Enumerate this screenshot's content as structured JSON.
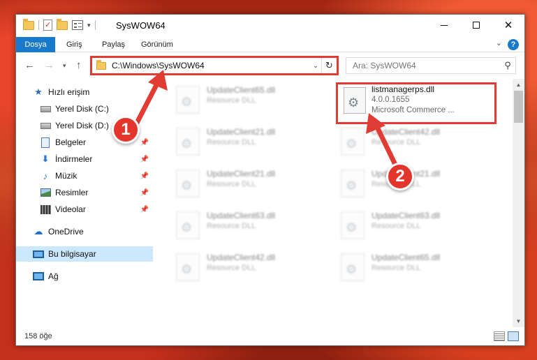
{
  "window": {
    "title": "SysWOW64",
    "minimize_label": "",
    "close_label": "✕"
  },
  "ribbon": {
    "tabs": [
      {
        "label": "Dosya"
      },
      {
        "label": "Giriş"
      },
      {
        "label": "Paylaş"
      },
      {
        "label": "Görünüm"
      }
    ],
    "help": "?"
  },
  "nav": {
    "address": "C:\\Windows\\SysWOW64",
    "search_placeholder": "Ara: SysWOW64"
  },
  "sidebar": {
    "items": [
      {
        "label": "Hızlı erişim"
      },
      {
        "label": "Yerel Disk (C:)"
      },
      {
        "label": "Yerel Disk (D:)"
      },
      {
        "label": "Belgeler"
      },
      {
        "label": "İndirmeler"
      },
      {
        "label": "Müzik"
      },
      {
        "label": "Resimler"
      },
      {
        "label": "Videolar"
      },
      {
        "label": "OneDrive"
      },
      {
        "label": "Bu bilgisayar"
      },
      {
        "label": "Ağ"
      }
    ]
  },
  "files": {
    "left": [
      {
        "name": "UpdateClient65.dll",
        "type": "Resource DLL"
      },
      {
        "name": "UpdateClient21.dll",
        "type": "Resource DLL"
      },
      {
        "name": "UpdateClient21.dll",
        "type": "Resource DLL"
      },
      {
        "name": "UpdateClient63.dll",
        "type": "Resource DLL"
      },
      {
        "name": "UpdateClient42.dll",
        "type": "Resource DLL"
      }
    ],
    "right": [
      {
        "name": "UpdateClient42.dll",
        "type": "Resource DLL"
      },
      {
        "name": "UpdateClient21.dll",
        "type": "Resource DLL"
      },
      {
        "name": "UpdateClient63.dll",
        "type": "Resource DLL"
      },
      {
        "name": "UpdateClient65.dll",
        "type": "Resource DLL"
      }
    ],
    "target": {
      "name": "listmanagerps.dll",
      "version": "4.0.0.1655",
      "company": "Microsoft Commerce ..."
    }
  },
  "status": {
    "count": "158 öğe"
  },
  "annotations": {
    "step1": "1",
    "step2": "2",
    "color": "#e03c33"
  }
}
